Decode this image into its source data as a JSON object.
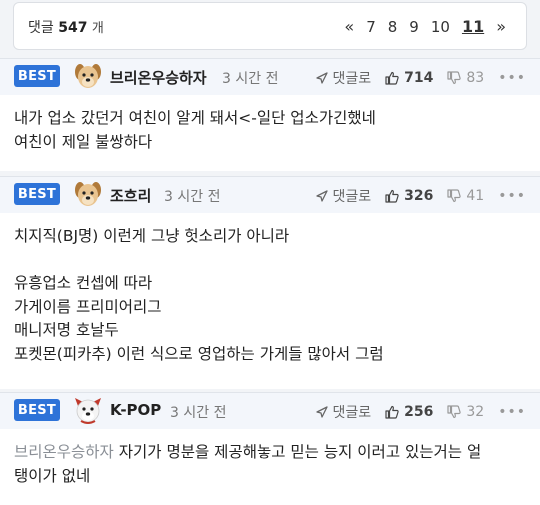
{
  "pager": {
    "count_label": "댓글",
    "count": "547",
    "count_unit": "개",
    "prev": "«",
    "pages": [
      "7",
      "8",
      "9",
      "10",
      "11"
    ],
    "current": "11",
    "next": "»"
  },
  "comments": [
    {
      "badge": "BEST",
      "avatar": "puppy-avatar-icon",
      "nickname": "브리온우승하자",
      "time": "3 시간 전",
      "reply_label": "댓글로",
      "likes": "714",
      "dislikes": "83",
      "lines": [
        "내가 업소 갔던거 여친이 알게 돼서<-일단 업소가긴했네",
        "여친이 제일 불쌍하다"
      ]
    },
    {
      "badge": "BEST",
      "avatar": "puppy-avatar-icon",
      "nickname": "조흐리",
      "time": "3 시간 전",
      "reply_label": "댓글로",
      "likes": "326",
      "dislikes": "41",
      "lines": [
        "치지직(BJ명) 이런게 그냥 헛소리가 아니라",
        "",
        "유흥업소 컨셉에 따라",
        "가게이름 프리미어리그",
        "매니저명 호날두",
        "포켓몬(피카추) 이런 식으로 영업하는 가게들 많아서 그럼"
      ]
    },
    {
      "badge": "BEST",
      "avatar": "puppy-avatar-icon",
      "nickname": "K-POP",
      "time": "3 시간 전",
      "reply_label": "댓글로",
      "likes": "256",
      "dislikes": "32",
      "mention": "브리온우승하자",
      "lines": [
        "자기가 명분을 제공해놓고 믿는 능지 이러고 있는거는 얼",
        "탱이가 없네"
      ]
    }
  ],
  "colors": {
    "badge": "#2e73d8",
    "header_bg": "#f3f6fb"
  }
}
